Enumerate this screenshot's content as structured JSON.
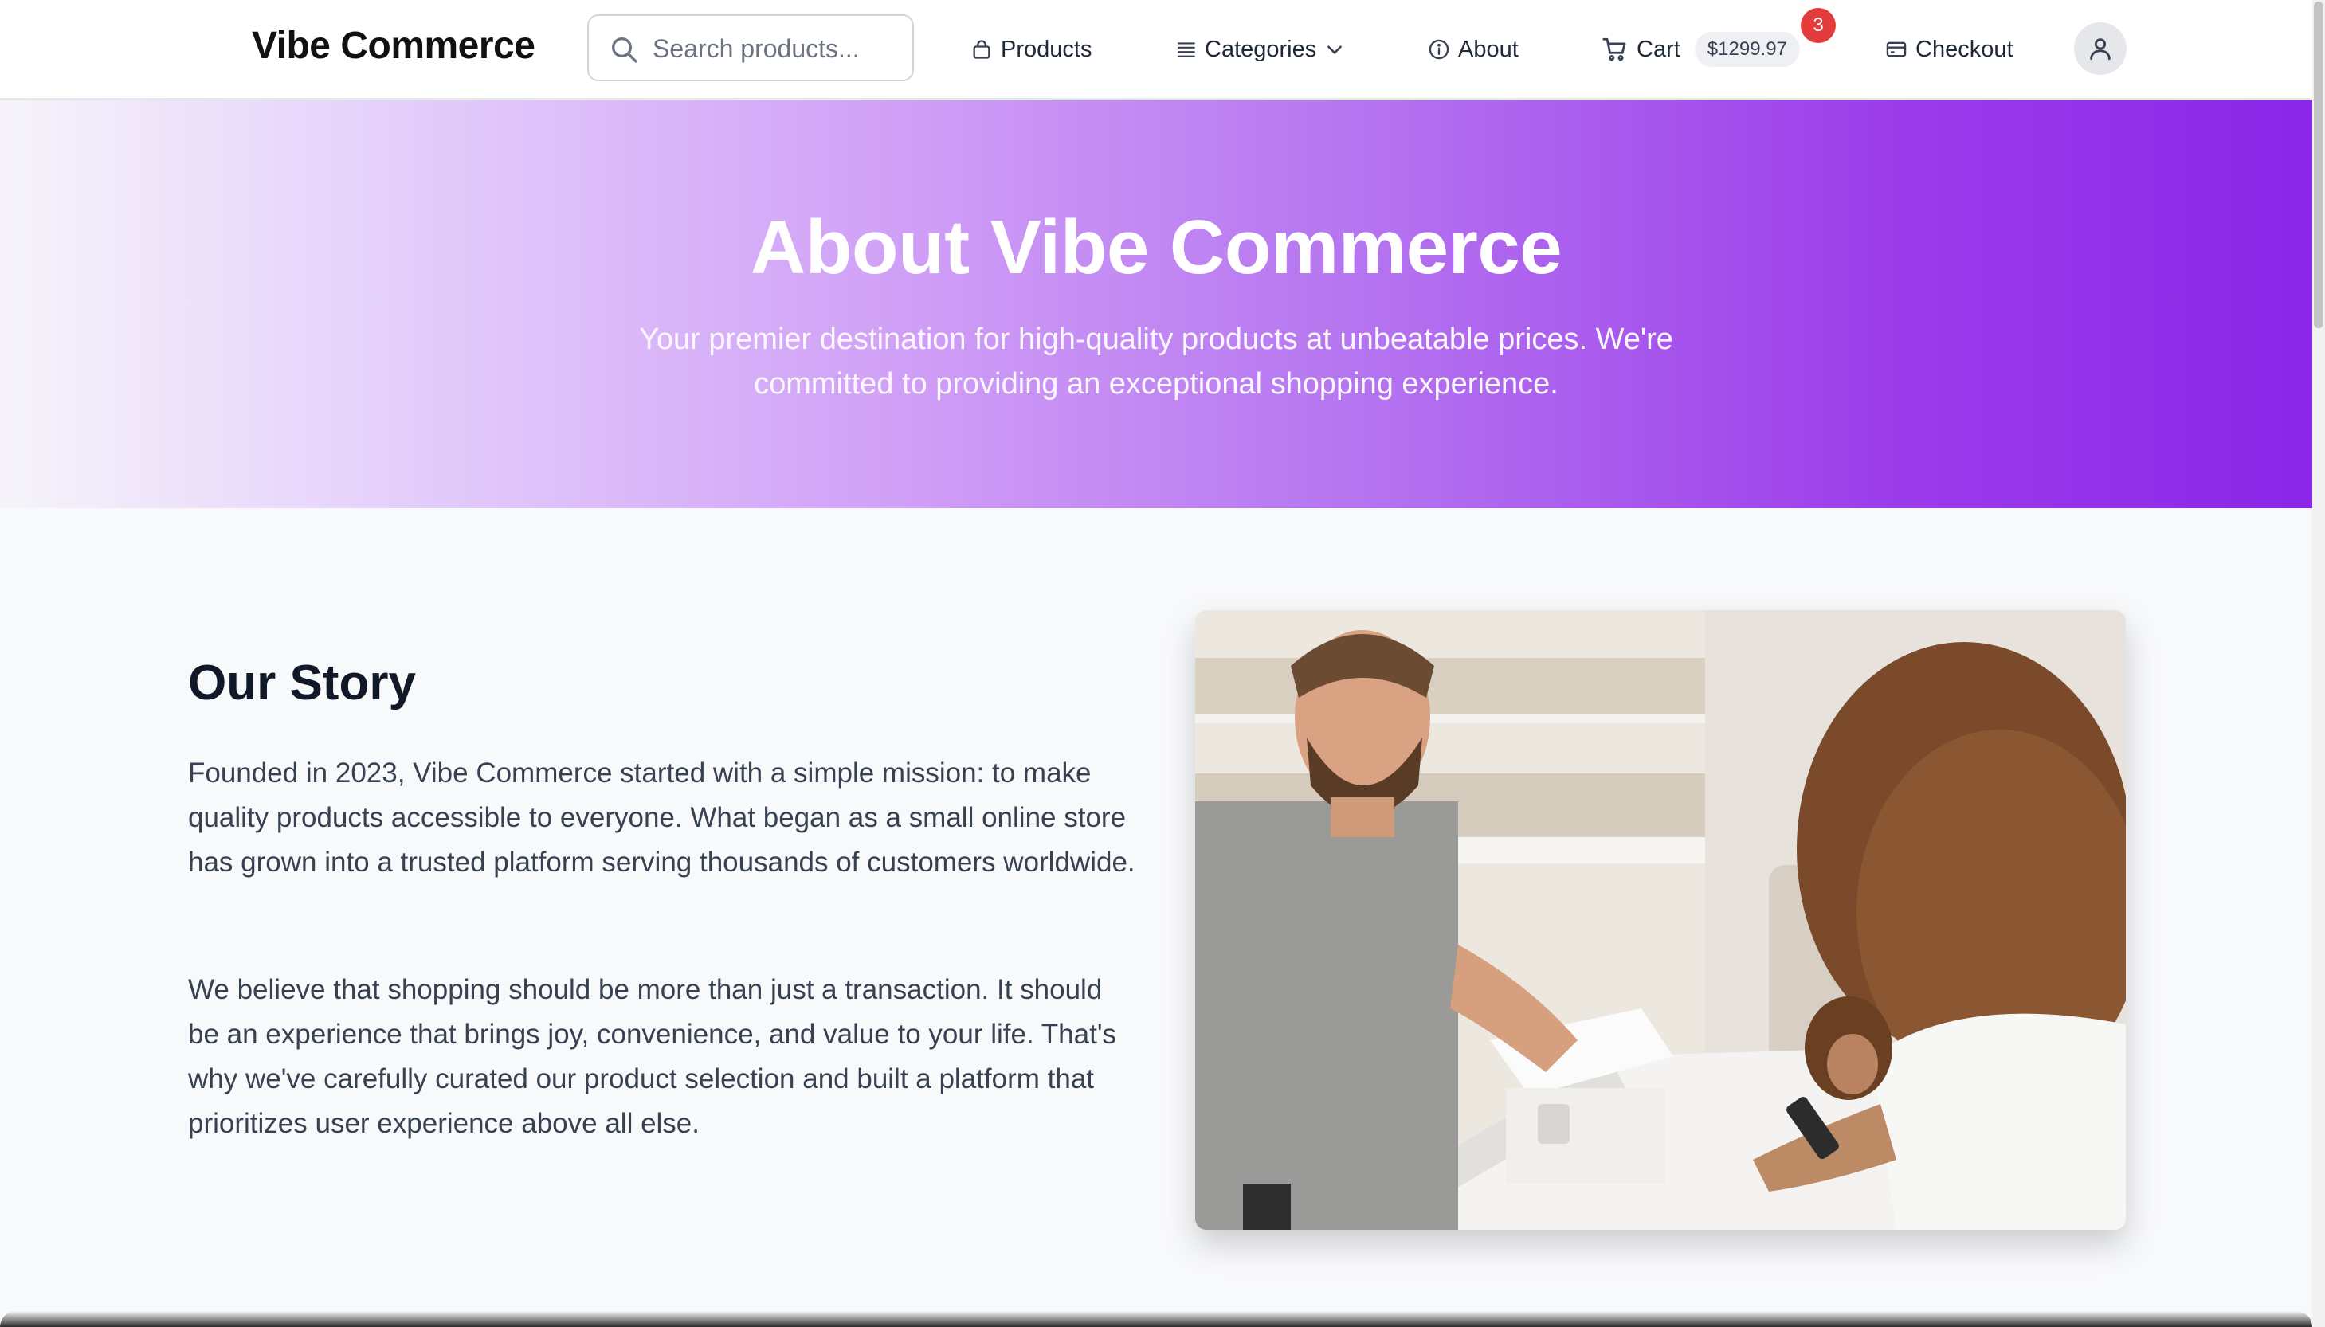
{
  "header": {
    "logo": "Vibe Commerce",
    "search_placeholder": "Search products...",
    "nav": {
      "products": "Products",
      "categories": "Categories",
      "about": "About",
      "cart": "Cart",
      "cart_total": "$1299.97",
      "cart_count": "3",
      "checkout": "Checkout"
    },
    "icons": [
      "search-icon",
      "bag-icon",
      "list-icon",
      "chevron-down-icon",
      "info-icon",
      "cart-icon",
      "card-icon",
      "user-icon"
    ]
  },
  "hero": {
    "title": "About Vibe Commerce",
    "subtitle": "Your premier destination for high-quality products at unbeatable prices. We're committed to providing an exceptional shopping experience."
  },
  "story": {
    "title": "Our Story",
    "paragraph1": "Founded in 2023, Vibe Commerce started with a simple mission: to make quality products accessible to everyone. What began as a small online store has grown into a trusted platform serving thousands of customers worldwide.",
    "paragraph2": "We believe that shopping should be more than just a transaction. It should be an experience that brings joy, convenience, and value to your life. That's why we've carefully curated our product selection and built a platform that prioritizes user experience above all else."
  },
  "colors": {
    "accent": "#8a26e8",
    "badge": "#e43c3c",
    "text": "#111827"
  }
}
